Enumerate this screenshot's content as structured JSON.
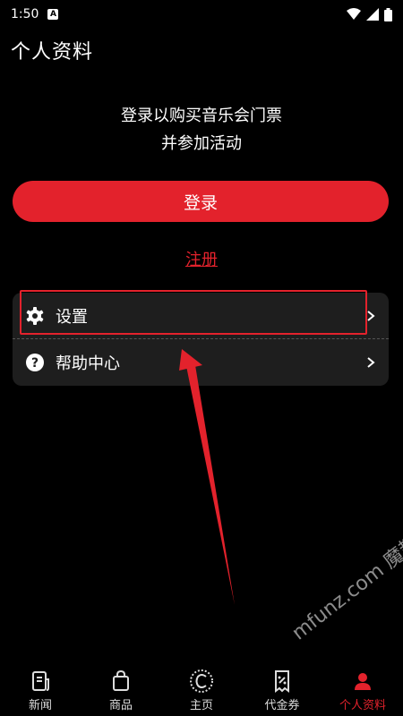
{
  "status_bar": {
    "time": "1:50",
    "notification": "A"
  },
  "page_title": "个人资料",
  "prompt": {
    "line1": "登录以购买音乐会门票",
    "line2": "并参加活动"
  },
  "login_button": "登录",
  "register_link": "注册",
  "menu": [
    {
      "label": "设置",
      "icon": "gear-icon"
    },
    {
      "label": "帮助中心",
      "icon": "help-icon"
    }
  ],
  "watermark": "mfunz.com 魔趣网",
  "bottom_nav": [
    {
      "label": "新闻",
      "icon": "news-icon"
    },
    {
      "label": "商品",
      "icon": "shopping-bag-icon"
    },
    {
      "label": "主页",
      "icon": "home-icon"
    },
    {
      "label": "代金券",
      "icon": "voucher-icon"
    },
    {
      "label": "个人资料",
      "icon": "profile-icon",
      "active": true
    }
  ],
  "colors": {
    "accent": "#e3222c",
    "background": "#000000",
    "card": "#1e1e1e"
  }
}
